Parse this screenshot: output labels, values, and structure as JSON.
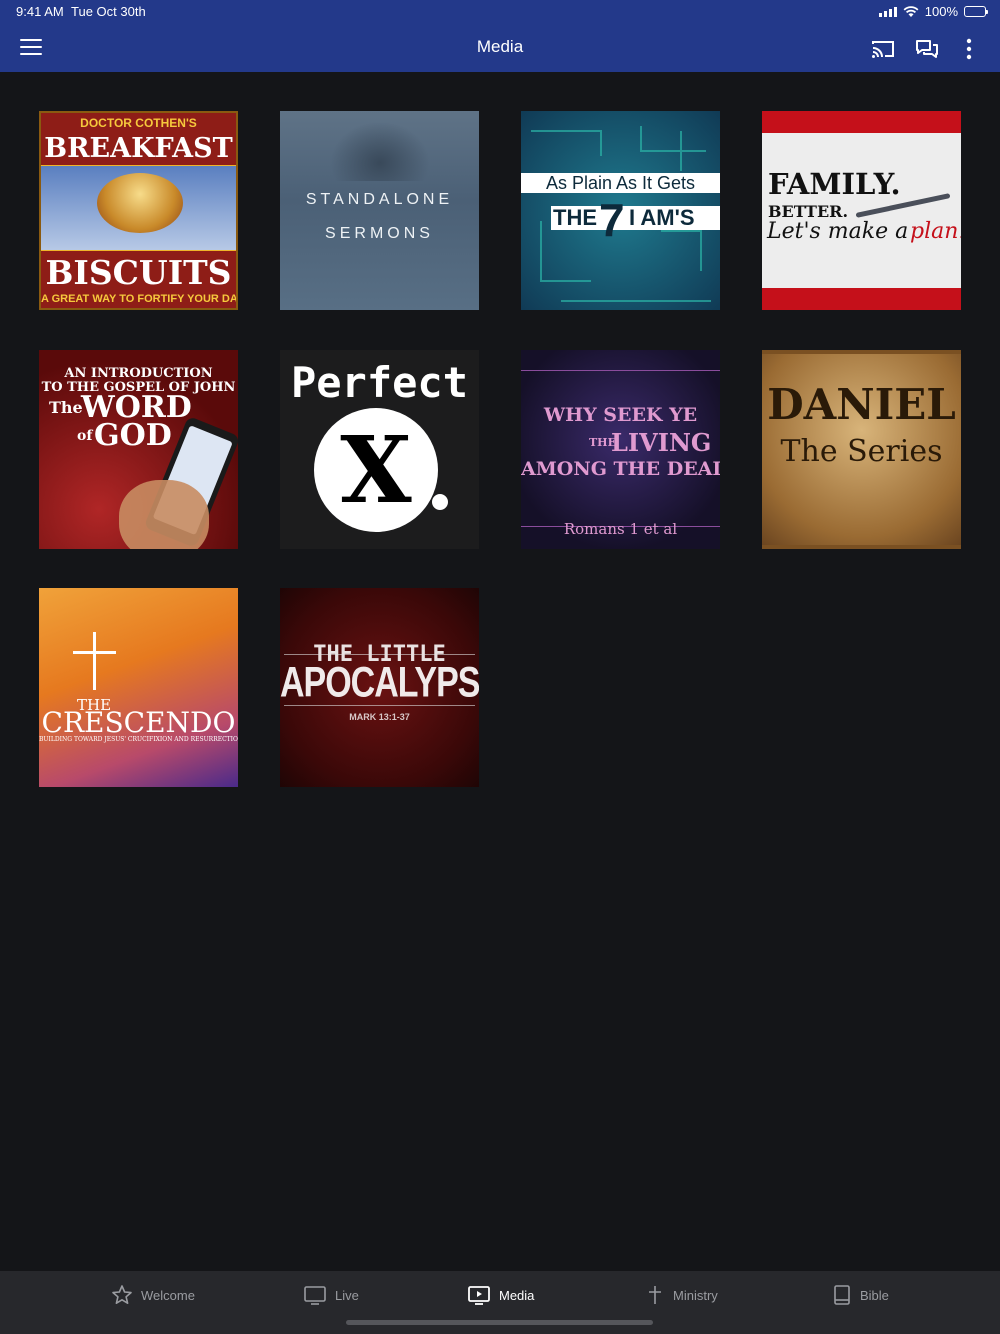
{
  "status": {
    "time": "9:41 AM",
    "date": "Tue Oct 30th",
    "battery": "100%"
  },
  "header": {
    "title": "Media"
  },
  "tiles": [
    {
      "lines": [
        "DOCTOR COTHEN'S",
        "BREAKFAST",
        "BISCUITS",
        "A GREAT WAY TO FORTIFY YOUR DAY"
      ]
    },
    {
      "lines": [
        "STANDALONE",
        "SERMONS"
      ]
    },
    {
      "lines": [
        "As Plain As It Gets",
        "THE",
        "7",
        "I AM'S"
      ]
    },
    {
      "lines": [
        "FAMILY.",
        "BETTER.",
        "Let's make a",
        "plan."
      ]
    },
    {
      "lines": [
        "AN INTRODUCTION",
        "TO THE GOSPEL OF JOHN",
        "The",
        "WORD",
        "of",
        "GOD"
      ]
    },
    {
      "lines": [
        "Perfect",
        "X"
      ]
    },
    {
      "lines": [
        "WHY SEEK YE",
        "THE",
        "LIVING",
        "AMONG THE DEAD?",
        "Romans 1 et al"
      ]
    },
    {
      "lines": [
        "DANIEL",
        "The Series"
      ]
    },
    {
      "lines": [
        "THE",
        "CRESCENDO",
        "BUILDING TOWARD JESUS' CRUCIFIXION AND RESURRECTION"
      ]
    },
    {
      "lines": [
        "THE LITTLE",
        "APOCALYPSE",
        "MARK 13:1-37"
      ]
    }
  ],
  "tabs": [
    {
      "label": "Welcome",
      "icon": "star-icon"
    },
    {
      "label": "Live",
      "icon": "tv-icon"
    },
    {
      "label": "Media",
      "icon": "play-screen-icon"
    },
    {
      "label": "Ministry",
      "icon": "cross-icon"
    },
    {
      "label": "Bible",
      "icon": "book-icon"
    }
  ],
  "colors": {
    "nav": "#23398a",
    "background": "#141518",
    "tabbar": "#27282c",
    "tab_inactive": "#9a9ca1",
    "tab_active": "#ffffff"
  }
}
